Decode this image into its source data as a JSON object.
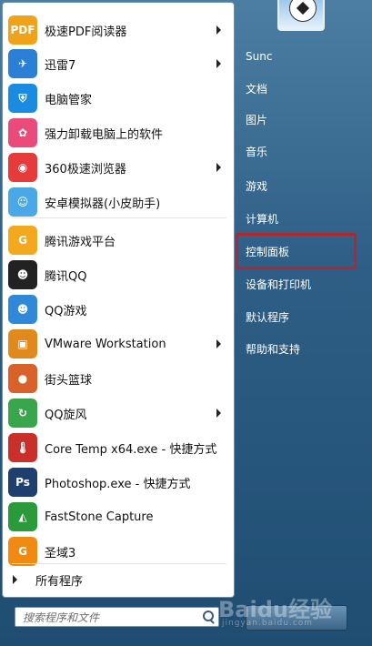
{
  "programs": [
    {
      "label": "极速PDF阅读器",
      "icon": "pdf-reader-icon",
      "color": "#f0a21a",
      "submenu": true,
      "glyph": "PDF"
    },
    {
      "label": "迅雷7",
      "icon": "xunlei-bird-icon",
      "color": "#2b7fd4",
      "submenu": true,
      "glyph": "✈"
    },
    {
      "label": "电脑管家",
      "icon": "pc-manager-shield-icon",
      "color": "#1a8be0",
      "submenu": false,
      "glyph": "⛨"
    },
    {
      "label": "强力卸载电脑上的软件",
      "icon": "uninstaller-flower-icon",
      "color": "#e94b7a",
      "submenu": false,
      "glyph": "✿"
    },
    {
      "label": "360极速浏览器",
      "icon": "browser-360-icon",
      "color": "#e53b3b",
      "submenu": true,
      "glyph": "◉"
    },
    {
      "label": "安卓模拟器(小皮助手)",
      "icon": "android-emulator-icon",
      "color": "#4aa8e6",
      "submenu": false,
      "glyph": "☺"
    },
    {
      "label": "腾讯游戏平台",
      "icon": "tencent-game-platform-icon",
      "color": "#f3a81d",
      "submenu": false,
      "glyph": "G"
    },
    {
      "label": "腾讯QQ",
      "icon": "qq-penguin-icon",
      "color": "#222222",
      "submenu": false,
      "glyph": "☻"
    },
    {
      "label": "QQ游戏",
      "icon": "qq-game-icon",
      "color": "#2f88d8",
      "submenu": false,
      "glyph": "☻"
    },
    {
      "label": "VMware Workstation",
      "icon": "vmware-icon",
      "color": "#e08a1e",
      "submenu": true,
      "glyph": "▣"
    },
    {
      "label": "街头篮球",
      "icon": "basketball-icon",
      "color": "#d9622b",
      "submenu": false,
      "glyph": "●"
    },
    {
      "label": "QQ旋风",
      "icon": "qq-whirlwind-icon",
      "color": "#3aa64b",
      "submenu": true,
      "glyph": "↻"
    },
    {
      "label": "Core Temp x64.exe - 快捷方式",
      "icon": "thermometer-icon",
      "color": "#c9302c",
      "submenu": false,
      "glyph": "🌡"
    },
    {
      "label": "Photoshop.exe - 快捷方式",
      "icon": "photoshop-icon",
      "color": "#1f3f6e",
      "submenu": false,
      "glyph": "Ps"
    },
    {
      "label": "FastStone Capture",
      "icon": "faststone-capture-icon",
      "color": "#2a9a3a",
      "submenu": false,
      "glyph": "◭"
    },
    {
      "label": "圣域3",
      "icon": "game-g-icon",
      "color": "#f08a12",
      "submenu": false,
      "glyph": "G"
    }
  ],
  "all_programs_label": "所有程序",
  "search_placeholder": "搜索程序和文件",
  "right_items": [
    {
      "label": "Sunc",
      "name": "menu-user-sunc"
    },
    {
      "label": "文档",
      "name": "menu-documents"
    },
    {
      "label": "图片",
      "name": "menu-pictures"
    },
    {
      "label": "音乐",
      "name": "menu-music"
    },
    {
      "label": "游戏",
      "name": "menu-games"
    },
    {
      "label": "计算机",
      "name": "menu-computer"
    },
    {
      "label": "控制面板",
      "name": "menu-control-panel"
    },
    {
      "label": "设备和打印机",
      "name": "menu-devices-printers"
    },
    {
      "label": "默认程序",
      "name": "menu-default-programs"
    },
    {
      "label": "帮助和支持",
      "name": "menu-help-support"
    }
  ],
  "watermark": {
    "big": "Baidu经验",
    "small": "jingyan.baidu.com"
  }
}
